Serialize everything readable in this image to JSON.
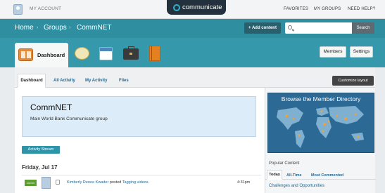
{
  "topbar": {
    "my_account": "MY ACCOUNT",
    "brand": "communicate",
    "links": [
      "FAVORITES",
      "MY GROUPS",
      "NEED HELP?"
    ]
  },
  "header": {
    "breadcrumb": [
      "Home",
      "Groups",
      "CommNET"
    ],
    "separator": "›",
    "add_content": "+ Add content",
    "search_placeholder": "",
    "search_button": "Search"
  },
  "appstrip": {
    "dashboard_label": "Dashboard",
    "icons": [
      "chat-icon",
      "calendar-icon",
      "briefcase-icon",
      "book-icon"
    ],
    "members": "Members",
    "settings": "Settings"
  },
  "tabs": [
    "Dashboard",
    "All Activity",
    "My Activity",
    "Files"
  ],
  "customize": "Customize layout",
  "group": {
    "title": "CommNET",
    "description": "Main World Bank Communicate group"
  },
  "stream_button": "Activity Stream",
  "activity": {
    "date": "Friday, Jul 17",
    "badge": "comm",
    "user": "Kimberly Renee Kwader",
    "verb": "posted",
    "item": "Tagging videos.",
    "time": "4:31pm"
  },
  "sidebar": {
    "map_title": "Browse the Member Directory",
    "popular_title": "Popular Content",
    "popular_tabs": [
      "Today",
      "All-Time",
      "Most Commented"
    ],
    "first_item": "Challenges and Opportunities"
  },
  "colors": {
    "header": "#2f8fa0",
    "strip": "#3599ab",
    "brand_dark": "#22313d",
    "link": "#1f6a98",
    "group_box": "#dcecf8"
  }
}
